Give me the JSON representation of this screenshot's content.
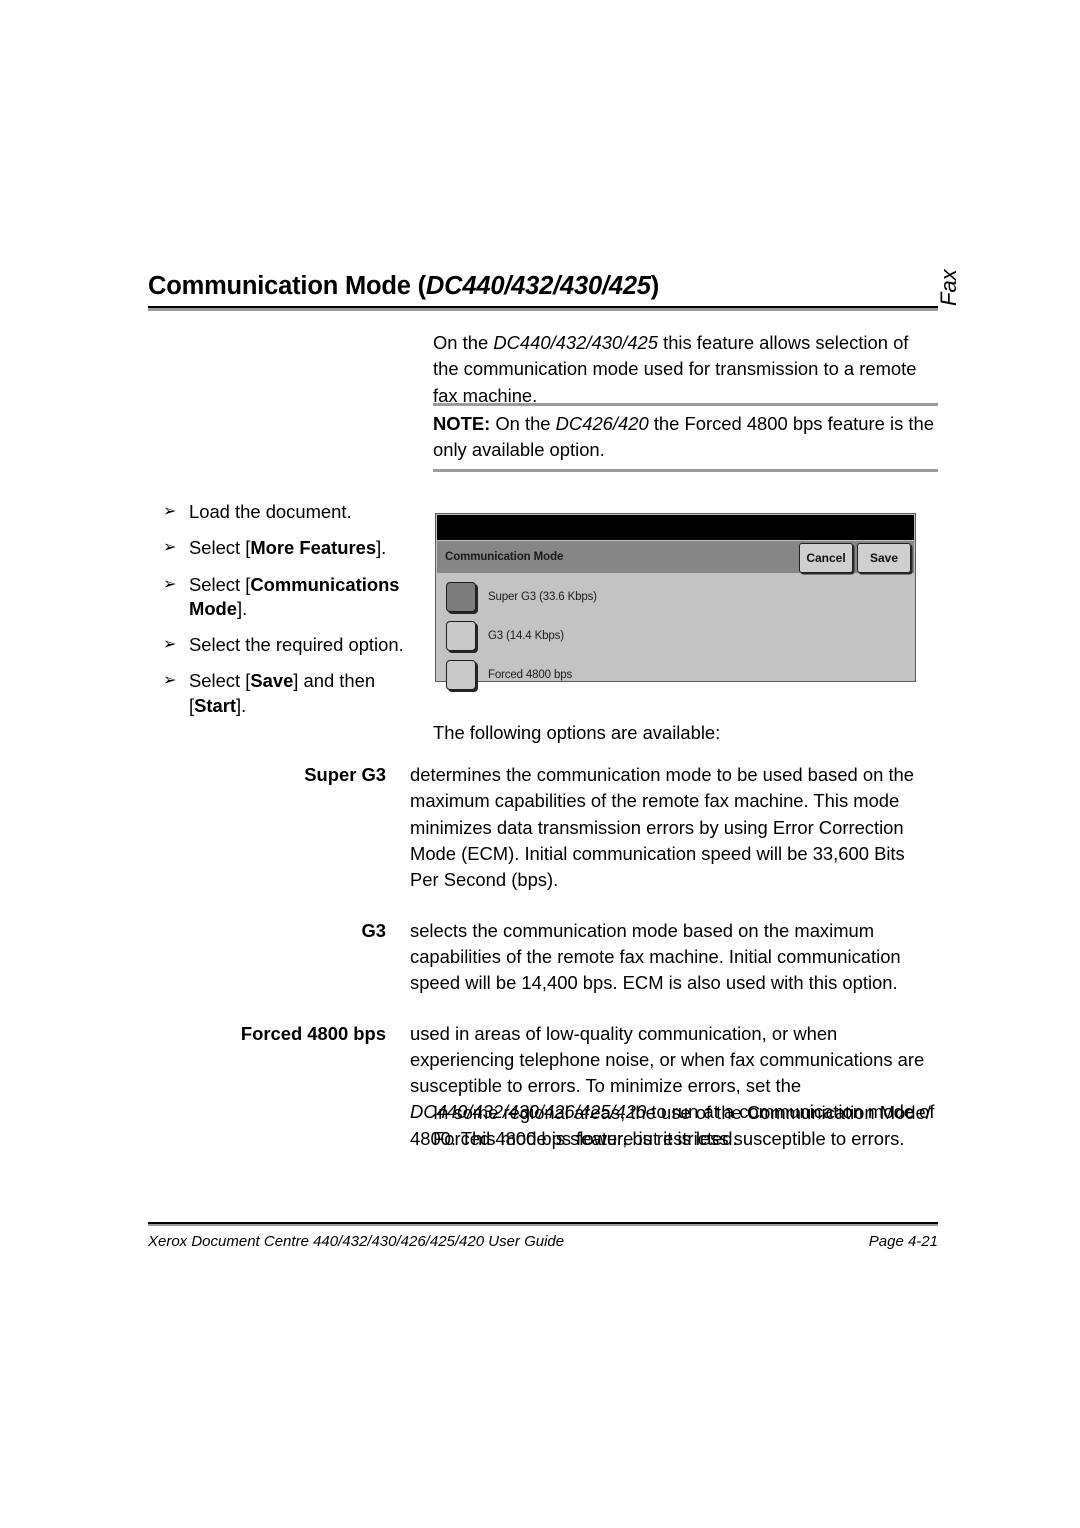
{
  "heading": {
    "title_prefix": "Communication Mode (",
    "title_models": "DC440/432/430/425",
    "title_suffix": ")"
  },
  "side_tab": {
    "label": "Fax"
  },
  "intro": {
    "part1": "On the ",
    "models": "DC440/432/430/425",
    "part2": " this feature allows selection of the communication mode used for transmission to a remote fax machine."
  },
  "note": {
    "label": "NOTE:",
    "part1": " On the ",
    "models": "DC426/420",
    "part2": " the Forced 4800 bps feature is the only available option."
  },
  "steps": {
    "marker": "➢",
    "items": [
      {
        "plain1": "Load the document.",
        "bold": "",
        "plain2": ""
      },
      {
        "plain1": "Select [",
        "bold": "More Features",
        "plain2": "]."
      },
      {
        "plain1": "Select [",
        "bold": "Communications Mode",
        "plain2": "]."
      },
      {
        "plain1": "Select the required option.",
        "bold": "",
        "plain2": ""
      },
      {
        "plain1": "Select [",
        "bold": "Save",
        "plain2": "] and then [",
        "bold2": "Start",
        "plain3": "]."
      }
    ]
  },
  "ui_panel": {
    "title": "Communication Mode",
    "cancel_label": "Cancel",
    "save_label": "Save",
    "options": [
      {
        "label": "Super G3 (33.6 Kbps)",
        "selected": true
      },
      {
        "label": "G3 (14.4 Kbps)",
        "selected": false
      },
      {
        "label": "Forced 4800 bps",
        "selected": false
      }
    ]
  },
  "following_line": "The following options are available:",
  "definitions": [
    {
      "term": "Super G3",
      "desc_part1": "determines the communication mode to be used based on the maximum capabilities of the remote fax machine. This mode minimizes data transmission errors by using Error Correction Mode (ECM). Initial communication speed will be 33,600 Bits Per Second (bps).",
      "desc_models": "",
      "desc_part2": ""
    },
    {
      "term": "G3",
      "desc_part1": "selects the communication mode based on the maximum capabilities of the remote fax machine. Initial communication speed will be 14,400 bps. ECM is also used with this option.",
      "desc_models": "",
      "desc_part2": ""
    },
    {
      "term": "Forced 4800 bps",
      "desc_part1": "used in areas of low-quality communication, or when experiencing telephone noise, or when fax communications are susceptible to errors. To minimize errors, set the ",
      "desc_models": "DC440/432/430/426/425/420",
      "desc_part2": " to run at a communication mode of 4800. This mode is slower, but it is less susceptible to errors."
    }
  ],
  "closing": "In some regional areas, the use of the Communication Mode/ Forced 4800 bps feature is restricted.",
  "footer": {
    "guide": "Xerox Document Centre 440/432/430/426/425/420 User Guide",
    "page": "Page 4-21"
  }
}
